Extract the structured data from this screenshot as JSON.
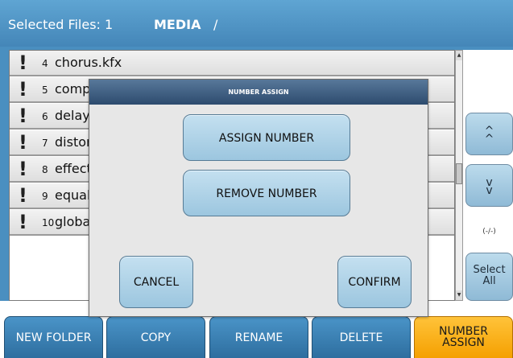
{
  "header": {
    "selected_label": "Selected Files: 1",
    "device": "MEDIA",
    "path": "/"
  },
  "files": [
    {
      "num": "4",
      "name": "chorus.kfx"
    },
    {
      "num": "5",
      "name": "compr"
    },
    {
      "num": "6",
      "name": "delay.l"
    },
    {
      "num": "7",
      "name": "distors"
    },
    {
      "num": "8",
      "name": "effectN"
    },
    {
      "num": "9",
      "name": "equali"
    },
    {
      "num": "10",
      "name": "globa"
    }
  ],
  "row_icon": "exclamation-icon",
  "right_panel": {
    "up": "^",
    "down": "v",
    "paging": "(-/-)",
    "select_all": [
      "Select",
      "All"
    ]
  },
  "tabs": {
    "new_folder": "NEW FOLDER",
    "copy": "COPY",
    "rename": "RENAME",
    "delete": "DELETE",
    "number_assign": [
      "NUMBER",
      "ASSIGN"
    ]
  },
  "modal": {
    "title": "NUMBER ASSIGN",
    "assign_number": "ASSIGN NUMBER",
    "remove_number": "REMOVE NUMBER",
    "cancel": "CANCEL",
    "confirm": "CONFIRM"
  },
  "colors": {
    "accent": "#4486b8",
    "active_tab": "#f5a000",
    "button": "#9cc6df"
  }
}
